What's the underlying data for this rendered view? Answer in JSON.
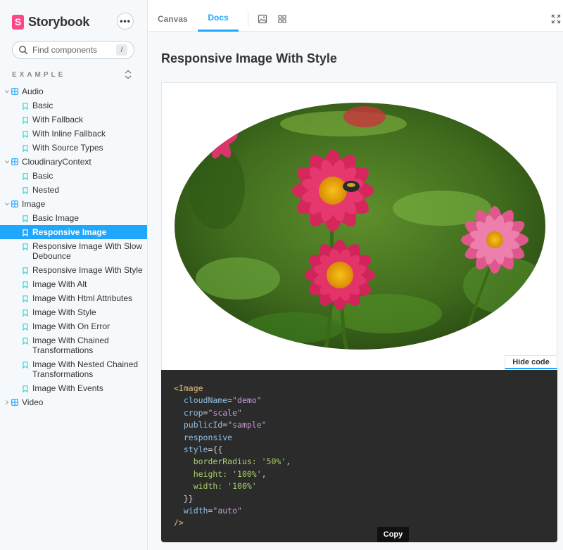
{
  "brand": {
    "name": "Storybook",
    "logo_letter": "S",
    "accent": "#ff4785"
  },
  "sidebar": {
    "search_placeholder": "Find components",
    "search_shortcut": "/",
    "section_title": "EXAMPLE",
    "tree": [
      {
        "type": "group",
        "label": "Audio"
      },
      {
        "type": "story",
        "label": "Basic"
      },
      {
        "type": "story",
        "label": "With Fallback"
      },
      {
        "type": "story",
        "label": "With Inline Fallback"
      },
      {
        "type": "story",
        "label": "With Source Types"
      },
      {
        "type": "group",
        "label": "CloudinaryContext"
      },
      {
        "type": "story",
        "label": "Basic"
      },
      {
        "type": "story",
        "label": "Nested"
      },
      {
        "type": "group",
        "label": "Image"
      },
      {
        "type": "story",
        "label": "Basic Image"
      },
      {
        "type": "story",
        "label": "Responsive Image",
        "selected": true
      },
      {
        "type": "story",
        "label": "Responsive Image With Slow Debounce"
      },
      {
        "type": "story",
        "label": "Responsive Image With Style"
      },
      {
        "type": "story",
        "label": "Image With Alt"
      },
      {
        "type": "story",
        "label": "Image With Html Attributes"
      },
      {
        "type": "story",
        "label": "Image With Style"
      },
      {
        "type": "story",
        "label": "Image With On Error"
      },
      {
        "type": "story",
        "label": "Image With Chained Transformations"
      },
      {
        "type": "story",
        "label": "Image With Nested Chained Transformations"
      },
      {
        "type": "story",
        "label": "Image With Events"
      },
      {
        "type": "group",
        "label": "Video",
        "collapsed": true
      }
    ]
  },
  "toolbar": {
    "tabs": [
      {
        "label": "Canvas",
        "active": false
      },
      {
        "label": "Docs",
        "active": true
      }
    ],
    "active_color": "#1ea7fd"
  },
  "doc": {
    "title": "Responsive Image With Style",
    "hide_code_label": "Hide code",
    "copy_label": "Copy"
  },
  "code_lines": [
    [
      {
        "t": "tag",
        "v": "<Image"
      }
    ],
    [
      {
        "t": "attr",
        "v": "  cloudName"
      },
      {
        "t": "punc",
        "v": "="
      },
      {
        "t": "str",
        "v": "\"demo\""
      }
    ],
    [
      {
        "t": "attr",
        "v": "  crop"
      },
      {
        "t": "punc",
        "v": "="
      },
      {
        "t": "str",
        "v": "\"scale\""
      }
    ],
    [
      {
        "t": "attr",
        "v": "  publicId"
      },
      {
        "t": "punc",
        "v": "="
      },
      {
        "t": "str",
        "v": "\"sample\""
      }
    ],
    [
      {
        "t": "attr",
        "v": "  responsive"
      }
    ],
    [
      {
        "t": "attr",
        "v": "  style"
      },
      {
        "t": "punc",
        "v": "={{"
      }
    ],
    [
      {
        "t": "strg",
        "v": "    borderRadius: "
      },
      {
        "t": "strg",
        "v": "'50%'"
      },
      {
        "t": "punc",
        "v": ","
      }
    ],
    [
      {
        "t": "strg",
        "v": "    height: "
      },
      {
        "t": "strg",
        "v": "'100%'"
      },
      {
        "t": "punc",
        "v": ","
      }
    ],
    [
      {
        "t": "strg",
        "v": "    width: "
      },
      {
        "t": "strg",
        "v": "'100%'"
      }
    ],
    [
      {
        "t": "punc",
        "v": "  }}"
      }
    ],
    [
      {
        "t": "attr",
        "v": "  width"
      },
      {
        "t": "punc",
        "v": "="
      },
      {
        "t": "str",
        "v": "\"auto\""
      }
    ],
    [
      {
        "t": "tag",
        "v": "/>"
      }
    ]
  ]
}
